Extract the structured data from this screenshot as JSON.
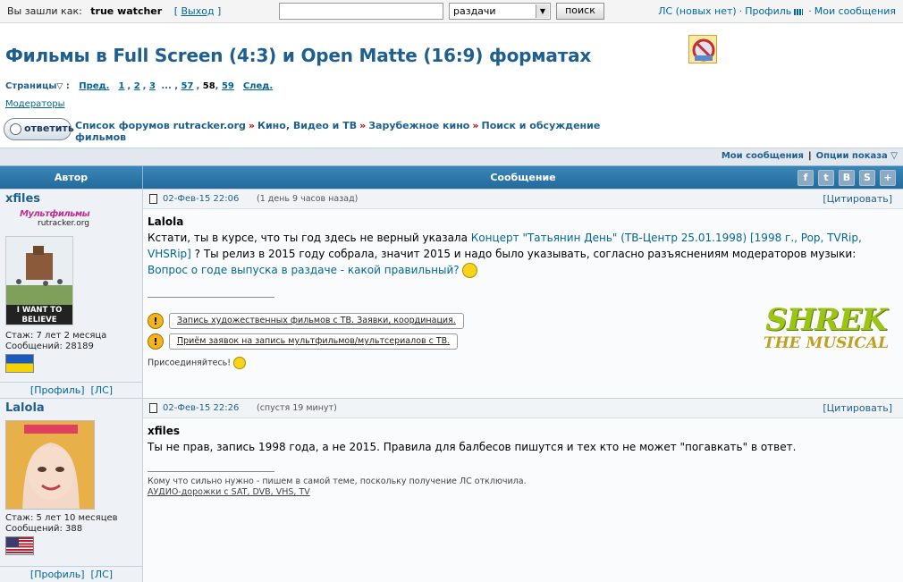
{
  "topbar": {
    "login_label": "Вы зашли как:",
    "username": "true watcher",
    "logout": "Выход",
    "search_value": "",
    "search_scope": "раздачи",
    "search_button": "поиск",
    "pm_link": "ЛС (новых нет)",
    "profile_link": "Профиль",
    "my_messages_link": "Мои сообщения"
  },
  "topic": {
    "title": "Фильмы в Full Screen (4:3) и Open Matte (16:9) форматах",
    "pages_label": "Страницы",
    "prev": "Пред.",
    "pages": [
      "1",
      "2",
      "3",
      "57"
    ],
    "current_page": "58",
    "last_page": "59",
    "next": "След.",
    "moderators": "Модераторы",
    "reply_button": "ответить"
  },
  "breadcrumb": [
    "Список форумов rutracker.org",
    "Кино, Видео и ТВ",
    "Зарубежное кино",
    "Поиск и обсуждение фильмов"
  ],
  "options": {
    "my_messages": "Мои сообщения",
    "display_options": "Опции показа"
  },
  "table": {
    "author_header": "Автор",
    "message_header": "Сообщение",
    "social": [
      "f",
      "t",
      "B",
      "S",
      "+"
    ]
  },
  "posts": [
    {
      "nick": "xfiles",
      "badge_text": "Мультфильмы",
      "badge_site": "rutracker.org",
      "avatar_caption": "I WANT TO BELIEVE",
      "tenure": "Стаж: 7 лет 2 месяца",
      "messages": "Сообщений: 28189",
      "profile": "[Профиль]",
      "pm": "[ЛС]",
      "date": "02-Фев-15 22:06",
      "ago": "(1 день 9 часов назад)",
      "quote": "[Цитировать]",
      "addressee": "Lalola",
      "text1": "Кстати, ты в курсе, что ты год здесь не верный указала ",
      "link1": "Концерт \"Татьянин День\" (ТВ-Центр 25.01.1998) [1998 г., Pop, TVRip, VHSRip]",
      "text2": " ? Ты релиз в 2015 году собрала, значит 2015 и надо было указывать, согласно разъяснениям модераторов музыки:",
      "link2": "Вопрос о годе выпуска в раздаче - какой правильный?",
      "sig_link1": "Запись художественных фильмов с ТВ. Заявки, координация.",
      "sig_link2": "Приём заявок на запись мультфильмов/мультсериалов с ТВ.",
      "join": "Присоединяйтесь!",
      "shrek_l1": "SHREK",
      "shrek_l2": "THE MUSICAL"
    },
    {
      "nick": "Lalola",
      "tenure": "Стаж: 5 лет 10 месяцев",
      "messages": "Сообщений: 388",
      "profile": "[Профиль]",
      "pm": "[ЛС]",
      "date": "02-Фев-15 22:26",
      "ago": "(спустя 19 минут)",
      "quote": "[Цитировать]",
      "addressee": "xfiles",
      "text": "Ты не прав, запись 1998 года, а не 2015. Правила для балбесов пишутся и тех кто не может \"погавкать\" в ответ.",
      "sig1": "Кому что сильно нужно - пишем в самой теме, поскольку получение ЛС отключила.",
      "sig2": "АУДИО-дорожки с SAT, DVB, VHS, TV"
    }
  ],
  "colors": {
    "link": "#006699",
    "title": "#1f5f8f",
    "header_bg": "#2f7aae",
    "breadcrumb_sep": "#b00000"
  }
}
